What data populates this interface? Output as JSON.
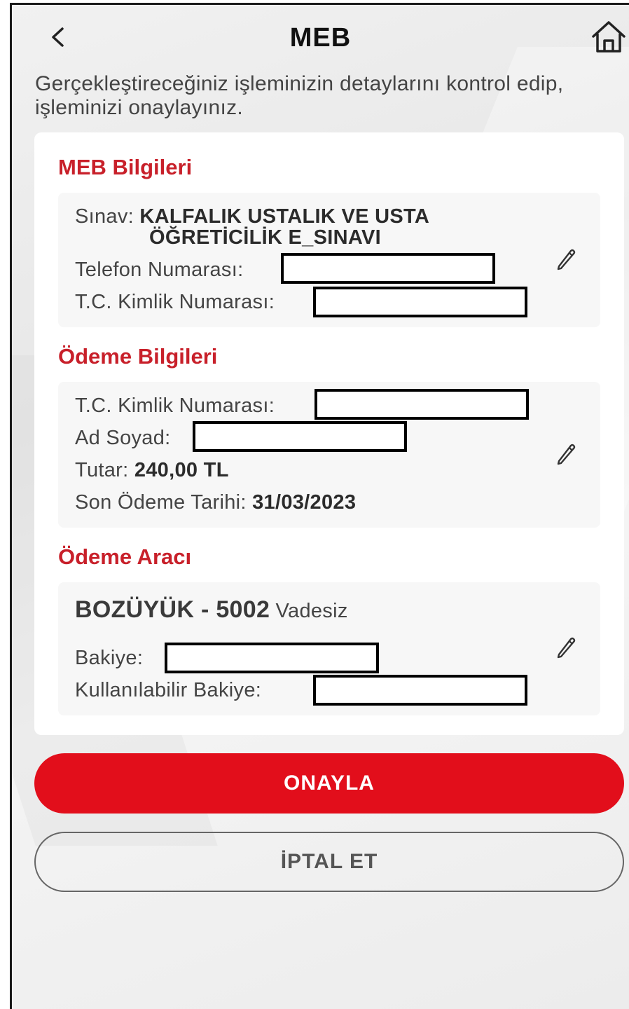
{
  "header": {
    "title": "MEB"
  },
  "intro": "Gerçekleştireceğiniz işleminizin detaylarını kontrol edip, işleminizi onaylayınız.",
  "meb_section": {
    "title": "MEB Bilgileri",
    "exam_label": "Sınav:",
    "exam_value_line1": "KALFALIK USTALIK VE USTA",
    "exam_value_line2": "ÖĞRETİCİLİK E_SINAVI",
    "phone_label": "Telefon Numarası:",
    "tc_label": "T.C. Kimlik Numarası:"
  },
  "payment_section": {
    "title": "Ödeme Bilgileri",
    "tc_label": "T.C. Kimlik Numarası:",
    "name_label": "Ad Soyad:",
    "amount_label": "Tutar:",
    "amount_value": "240,00 TL",
    "due_label": "Son Ödeme Tarihi:",
    "due_value": "31/03/2023"
  },
  "tool_section": {
    "title": "Ödeme Aracı",
    "account_name": "BOZÜYÜK - 5002",
    "account_type": "Vadesiz",
    "balance_label": "Bakiye:",
    "available_label": "Kullanılabilir Bakiye:"
  },
  "buttons": {
    "confirm": "ONAYLA",
    "cancel": "İPTAL ET"
  },
  "icons": {
    "back": "chevron-left-icon",
    "home": "home-icon",
    "edit": "pencil-icon"
  },
  "colors": {
    "accent": "#e20e1b",
    "section_title": "#c8202a"
  }
}
